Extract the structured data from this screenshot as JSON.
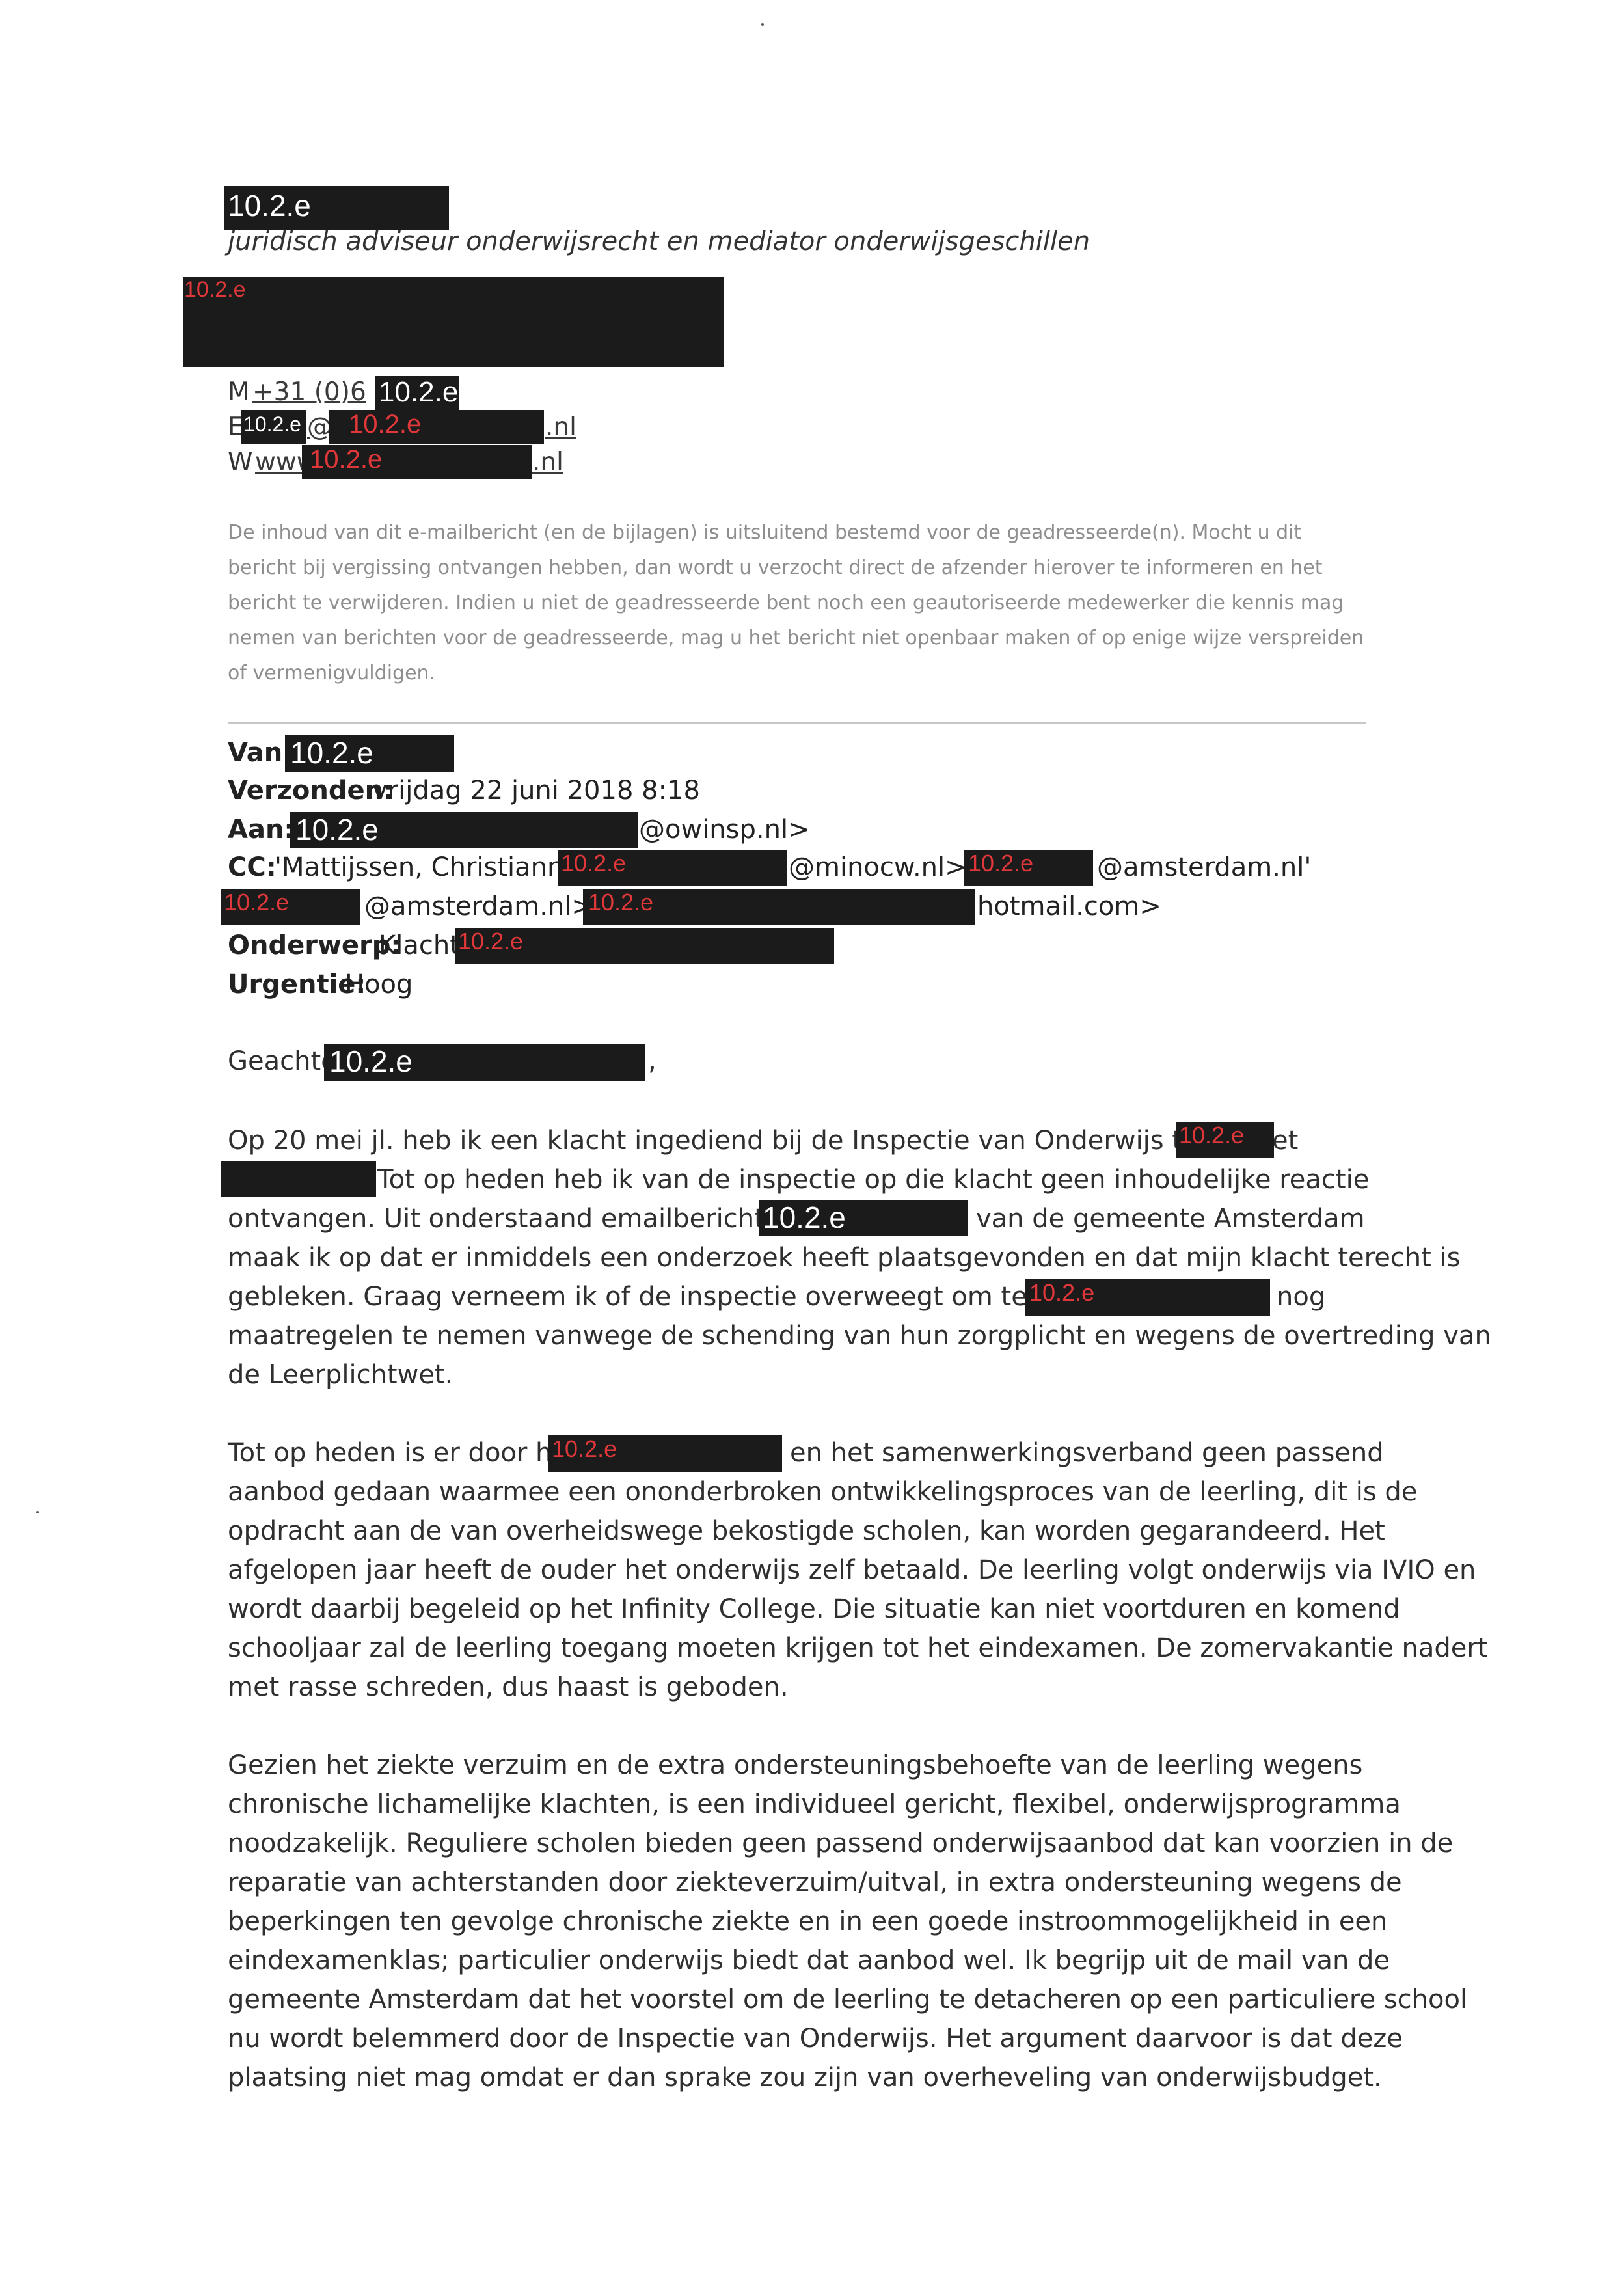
{
  "redaction_code": "10.2.e",
  "signature": {
    "role": "juridisch adviseur onderwijsrecht en mediator onderwijsgeschillen",
    "mobile_label": "M",
    "mobile_prefix": "+31 (0)6",
    "email_label": "E",
    "email_at": "@",
    "email_tld": ".nl",
    "web_label": "W",
    "web_prefix": "www",
    "web_tld": ".nl"
  },
  "disclaimer": "De inhoud van dit e-mailbericht (en de bijlagen) is uitsluitend bestemd voor de geadresseerde(n). Mocht u dit bericht bij vergissing ontvangen hebben, dan wordt u verzocht direct de afzender hierover te informeren en het bericht te verwijderen. Indien u niet de geadresseerde bent noch een geautoriseerde medewerker die kennis mag nemen van berichten voor de geadresseerde, mag u het bericht niet openbaar maken of op enige wijze verspreiden of vermenigvuldigen.",
  "header": {
    "from_label": "Van:",
    "sent_label": "Verzonden:",
    "sent_value": "vrijdag 22 juni 2018 8:18",
    "to_label": "Aan:",
    "to_suffix": "@owinsp.nl>",
    "cc_label": "CC:",
    "cc_name": "'Mattijssen, Christianne'",
    "cc_part2": "@minocw.nl>;",
    "cc_part3": "@amsterdam.nl'",
    "cc_part4": "@amsterdam.nl>;",
    "cc_part5": "hotmail.com>",
    "subject_label": "Onderwerp:",
    "subject_value": "Klacht",
    "urgency_label": "Urgentie:",
    "urgency_value": "Hoog"
  },
  "body": {
    "greeting": "Geachte",
    "greeting_end": ",",
    "p1_l1": "Op 20 mei jl. heb ik een klacht ingediend bij de Inspectie van Onderwijs tegen het",
    "p1_l2": "Tot op heden heb ik van de inspectie op die klacht geen inhoudelijke reactie",
    "p1_l3a": "ontvangen. Uit onderstaand emailbericht van",
    "p1_l3b": "van de gemeente Amsterdam",
    "p1_l4": "maak ik op dat er inmiddels een onderzoek heeft plaatsgevonden en dat mijn klacht terecht is",
    "p1_l5a": "gebleken. Graag verneem ik of de inspectie overweegt om tegen het",
    "p1_l5b": "nog",
    "p1_l6": "maatregelen te nemen vanwege de schending van hun zorgplicht en wegens de overtreding van",
    "p1_l7": "de Leerplichtwet.",
    "p2_l1a": "Tot op heden is er door het",
    "p2_l1b": "en het samenwerkingsverband geen passend",
    "p2_l2": "aanbod gedaan waarmee een ononderbroken ontwikkelingsproces van de leerling, dit is de",
    "p2_l3": "opdracht aan de van overheidswege bekostigde scholen, kan worden gegarandeerd. Het",
    "p2_l4": "afgelopen jaar heeft de ouder het onderwijs zelf betaald. De leerling volgt onderwijs via IVIO en",
    "p2_l5": "wordt daarbij begeleid op het Infinity College. Die situatie kan niet voortduren en komend",
    "p2_l6": "schooljaar zal de leerling toegang moeten krijgen tot het eindexamen. De zomervakantie nadert",
    "p2_l7": "met rasse schreden, dus haast is geboden.",
    "p3_l1": "Gezien het ziekte verzuim en de extra ondersteuningsbehoefte van de leerling wegens",
    "p3_l2": "chronische lichamelijke klachten, is een individueel gericht, flexibel, onderwijsprogramma",
    "p3_l3": "noodzakelijk. Reguliere scholen bieden geen passend onderwijsaanbod dat kan voorzien in de",
    "p3_l4": "reparatie van achterstanden door ziekteverzuim/uitval, in extra ondersteuning wegens de",
    "p3_l5": "beperkingen ten gevolge chronische ziekte en in een goede instroommogelijkheid in een",
    "p3_l6": "eindexamenklas; particulier onderwijs biedt dat aanbod wel. Ik begrijp uit de mail van de",
    "p3_l7": "gemeente Amsterdam dat het voorstel om de leerling te detacheren op een particuliere school",
    "p3_l8": "nu wordt belemmerd door de Inspectie van Onderwijs. Het argument daarvoor is dat deze",
    "p3_l9": "plaatsing niet mag omdat er dan sprake zou zijn van overheveling van onderwijsbudget."
  }
}
